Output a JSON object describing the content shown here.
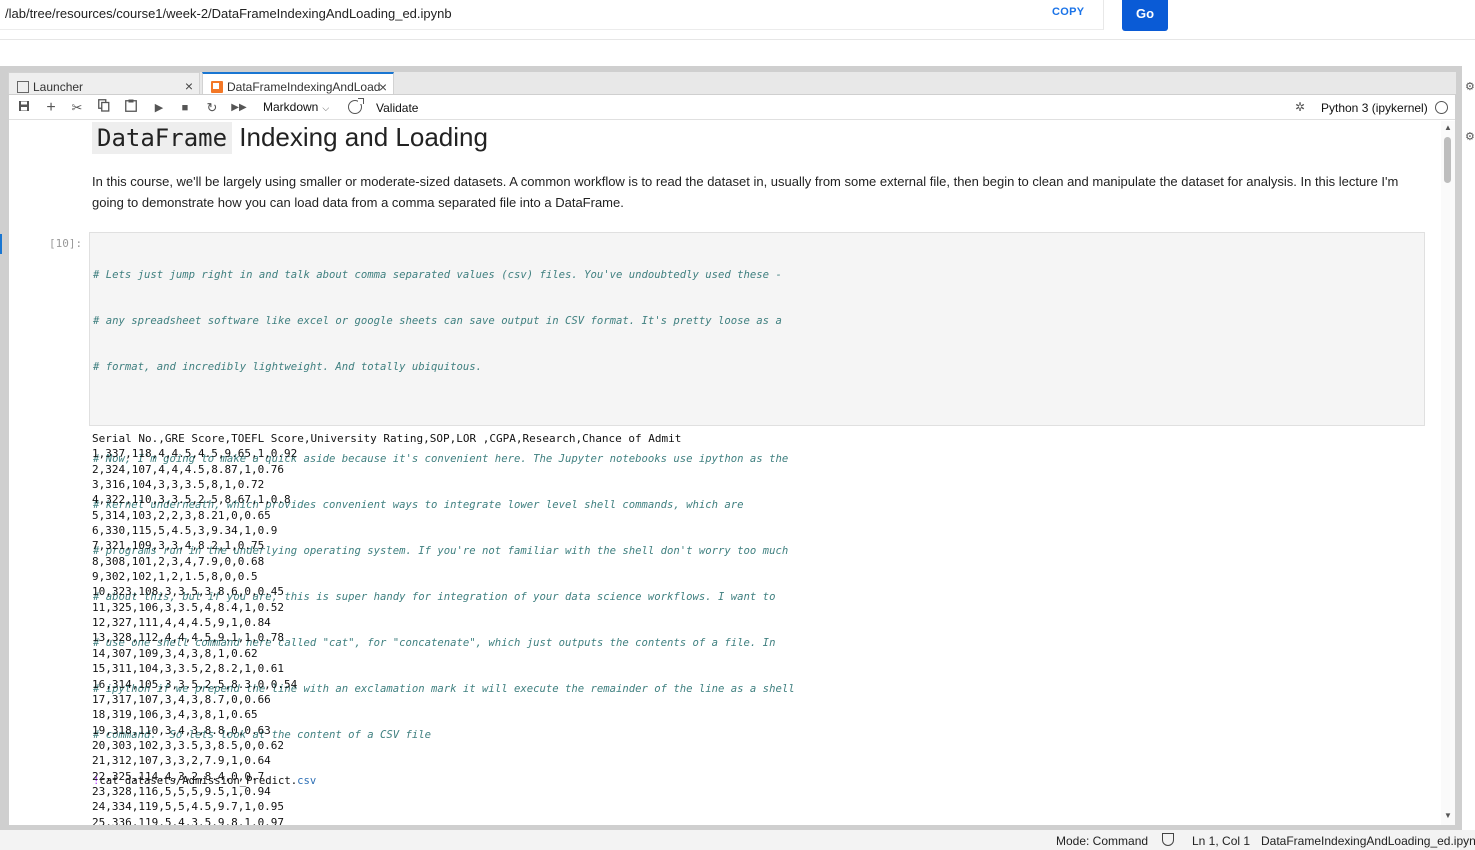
{
  "urlbar": {
    "url": "/lab/tree/resources/course1/week-2/DataFrameIndexingAndLoading_ed.ipynb",
    "copy_label": "COPY",
    "go_label": "Go"
  },
  "tabs": [
    {
      "label": "Launcher",
      "close": "×"
    },
    {
      "label": "DataFrameIndexingAndLoad",
      "close": "×"
    }
  ],
  "toolbar": {
    "cell_type": "Markdown",
    "validate_label": "Validate",
    "kernel": "Python 3 (ipykernel)"
  },
  "notebook": {
    "title_code": "DataFrame",
    "title_rest": " Indexing and Loading",
    "intro": "In this course, we'll be largely using smaller or moderate-sized datasets. A common workflow is to read the dataset in, usually from some external file, then begin to clean and manipulate the dataset for analysis. In this lecture I'm going to demonstrate how you can load data from a comma separated file into a DataFrame.",
    "prompt": "[10]:",
    "code_comments_1": [
      "# Lets just jump right in and talk about comma separated values (csv) files. You've undoubtedly used these -",
      "# any spreadsheet software like excel or google sheets can save output in CSV format. It's pretty loose as a",
      "# format, and incredibly lightweight. And totally ubiquitous."
    ],
    "code_comments_2": [
      "# Now, I'm going to make a quick aside because it's convenient here. The Jupyter notebooks use ipython as the",
      "# kernel underneath, which provides convenient ways to integrate lower level shell commands, which are",
      "# programs run in the underlying operating system. If you're not familiar with the shell don't worry too much",
      "# about this, but if you are, this is super handy for integration of your data science workflows. I want to",
      "# use one shell command here called \"cat\", for \"concatenate\", which just outputs the contents of a file. In",
      "# ipython if we prepend the line with an exclamation mark it will execute the remainder of the line as a shell",
      "# command.  So lets look at the content of a CSV file"
    ],
    "cmd_bang": "!",
    "cmd_text": "cat datasets/Admission_Predict.",
    "cmd_ext": "csv",
    "output": [
      "Serial No.,GRE Score,TOEFL Score,University Rating,SOP,LOR ,CGPA,Research,Chance of Admit",
      "1,337,118,4,4.5,4.5,9.65,1,0.92",
      "2,324,107,4,4,4.5,8.87,1,0.76",
      "3,316,104,3,3,3.5,8,1,0.72",
      "4,322,110,3,3.5,2.5,8.67,1,0.8",
      "5,314,103,2,2,3,8.21,0,0.65",
      "6,330,115,5,4.5,3,9.34,1,0.9",
      "7,321,109,3,3,4,8.2,1,0.75",
      "8,308,101,2,3,4,7.9,0,0.68",
      "9,302,102,1,2,1.5,8,0,0.5",
      "10,323,108,3,3.5,3,8.6,0,0.45",
      "11,325,106,3,3.5,4,8.4,1,0.52",
      "12,327,111,4,4,4.5,9,1,0.84",
      "13,328,112,4,4,4.5,9.1,1,0.78",
      "14,307,109,3,4,3,8,1,0.62",
      "15,311,104,3,3.5,2,8.2,1,0.61",
      "16,314,105,3,3.5,2.5,8.3,0,0.54",
      "17,317,107,3,4,3,8.7,0,0.66",
      "18,319,106,3,4,3,8,1,0.65",
      "19,318,110,3,4,3,8.8,0,0.63",
      "20,303,102,3,3.5,3,8.5,0,0.62",
      "21,312,107,3,3,2,7.9,1,0.64",
      "22,325,114,4,3,2,8.4,0,0.7",
      "23,328,116,5,5,5,9.5,1,0.94",
      "24,334,119,5,5,4.5,9.7,1,0.95",
      "25,336,119,5,4,3.5,9.8,1,0.97"
    ]
  },
  "statusbar": {
    "mode": "Mode: Command",
    "position": "Ln 1, Col 1",
    "file": "DataFrameIndexingAndLoading_ed.ipynb"
  }
}
